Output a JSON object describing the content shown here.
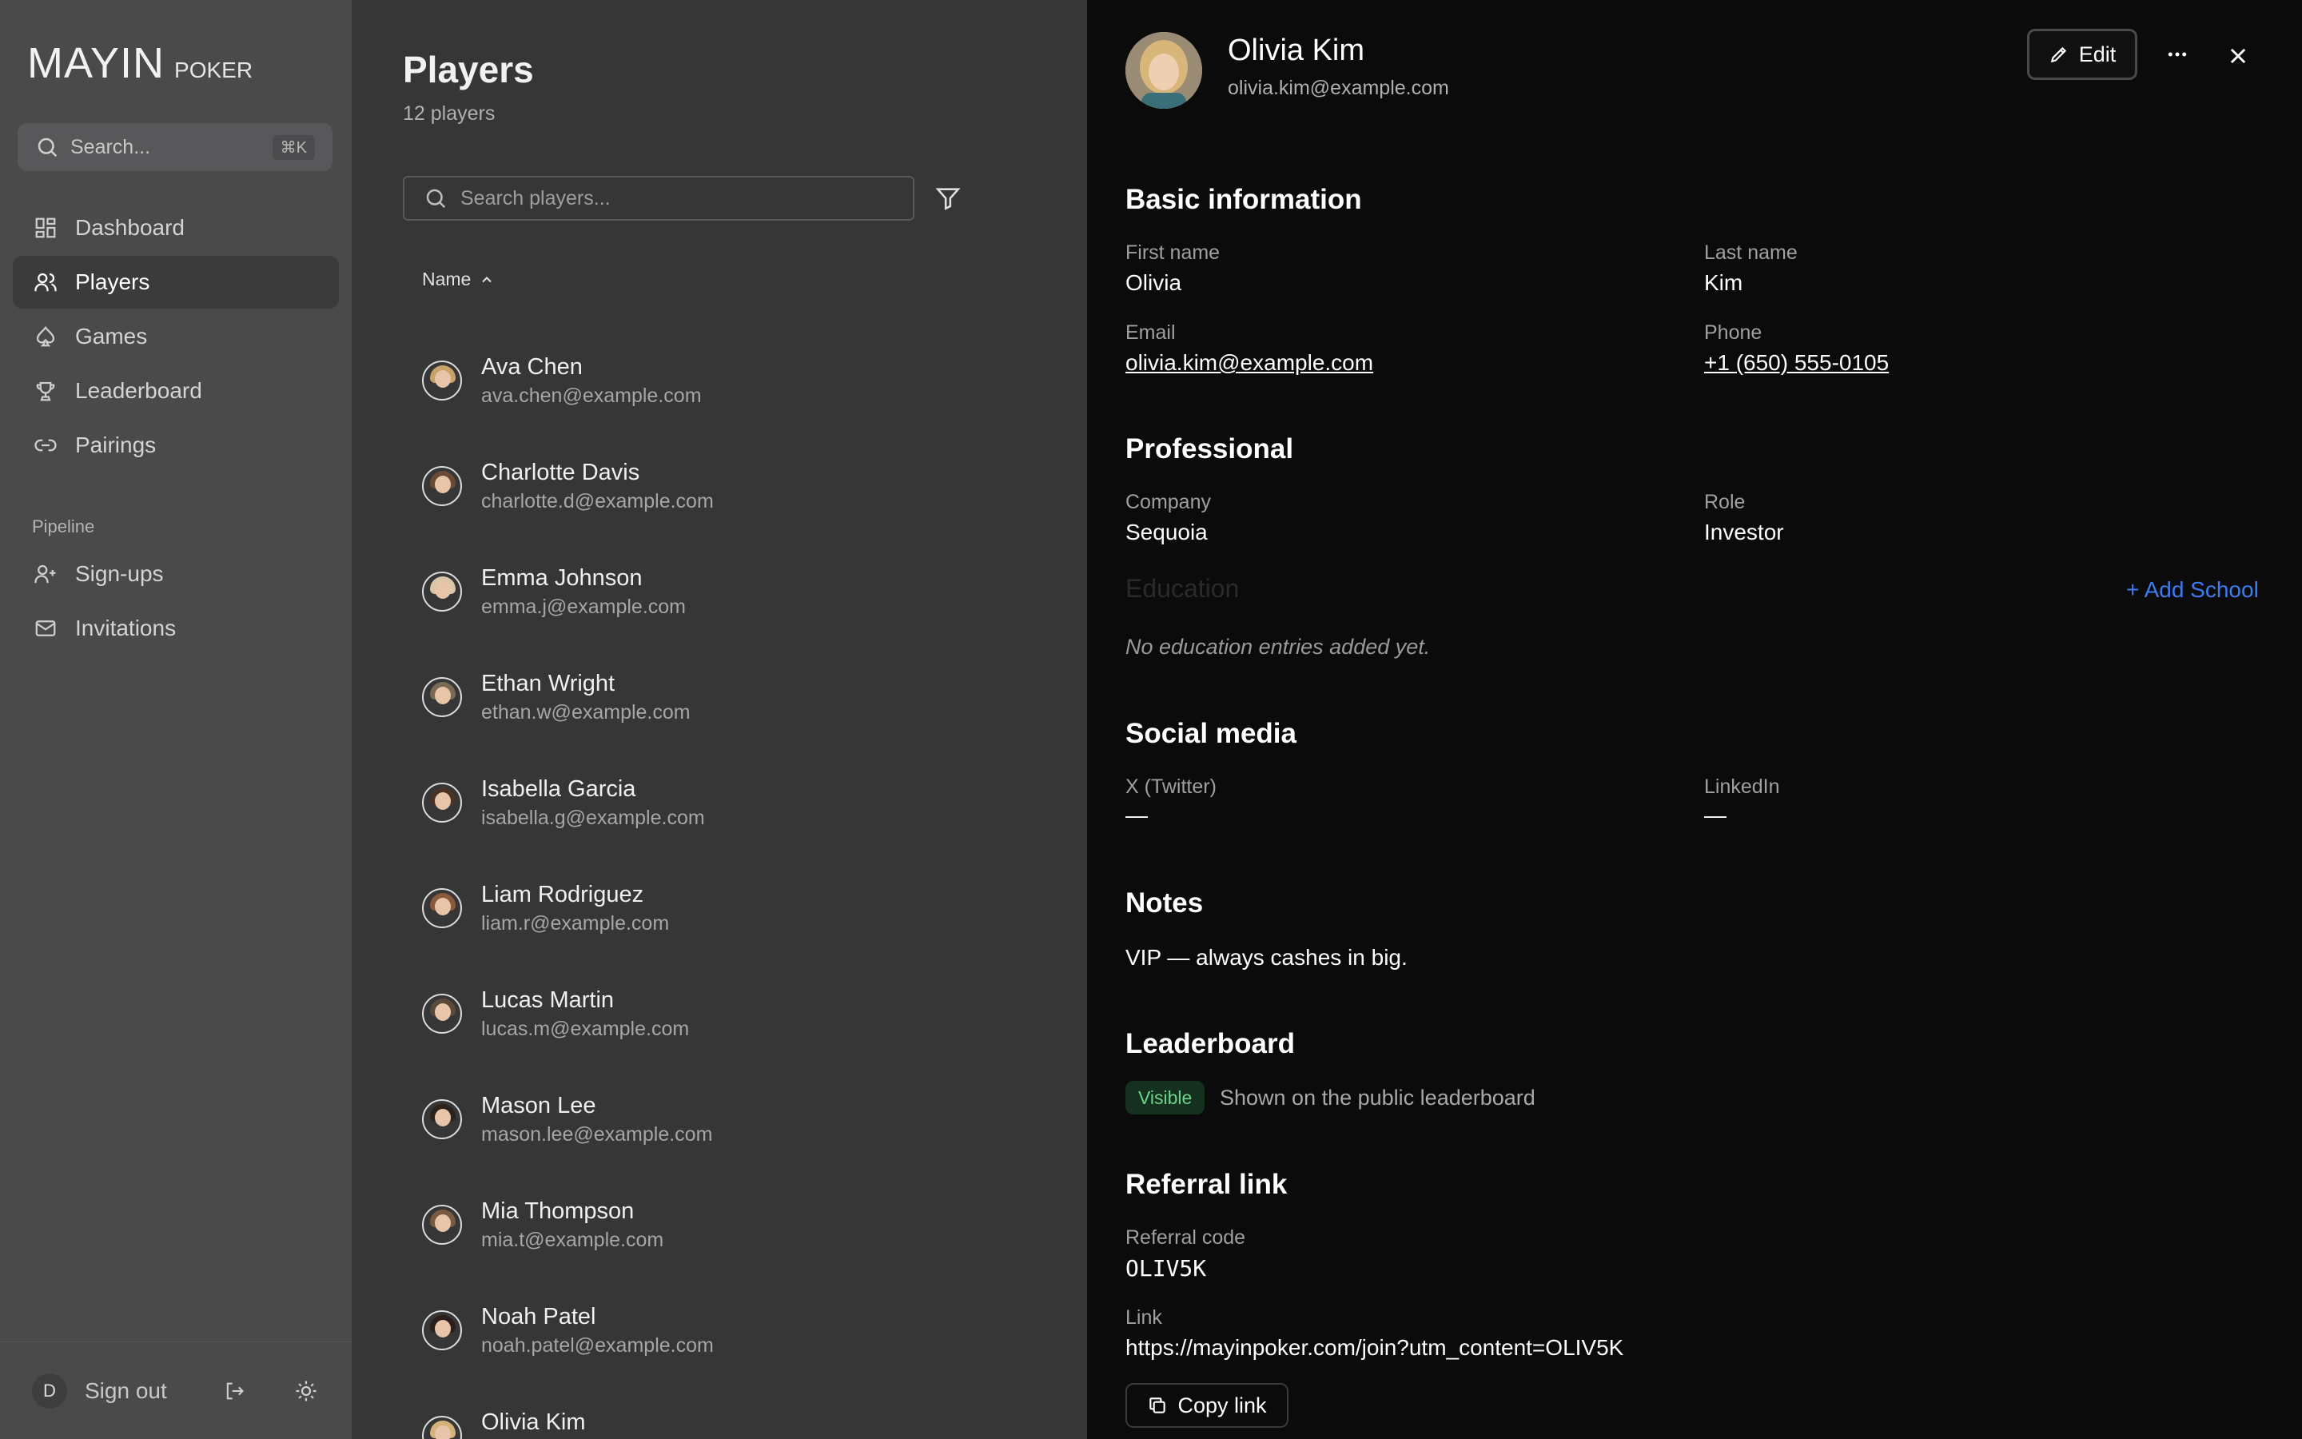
{
  "brand": {
    "main": "MAYIN",
    "sub": "POKER"
  },
  "sidebar": {
    "search_placeholder": "Search...",
    "search_shortcut": "⌘K",
    "items": [
      {
        "label": "Dashboard",
        "icon": "dashboard-icon"
      },
      {
        "label": "Players",
        "icon": "users-icon",
        "active": true
      },
      {
        "label": "Games",
        "icon": "spade-icon"
      },
      {
        "label": "Leaderboard",
        "icon": "trophy-icon"
      },
      {
        "label": "Pairings",
        "icon": "link-icon"
      }
    ],
    "section_label": "Pipeline",
    "pipeline_items": [
      {
        "label": "Sign-ups",
        "icon": "user-plus-icon"
      },
      {
        "label": "Invitations",
        "icon": "mail-icon"
      }
    ],
    "user_initial": "D",
    "signout_label": "Sign out"
  },
  "players": {
    "title": "Players",
    "count_label": "12 players",
    "search_placeholder": "Search players...",
    "column_header": "Name",
    "rows": [
      {
        "name": "Ava Chen",
        "email": "ava.chen@example.com",
        "hair": "#c9a26a"
      },
      {
        "name": "Charlotte Davis",
        "email": "charlotte.d@example.com",
        "hair": "#6b4a35"
      },
      {
        "name": "Emma Johnson",
        "email": "emma.j@example.com",
        "hair": "#d9c7a8"
      },
      {
        "name": "Ethan Wright",
        "email": "ethan.w@example.com",
        "hair": "#7a6a55"
      },
      {
        "name": "Isabella Garcia",
        "email": "isabella.g@example.com",
        "hair": "#4a3226"
      },
      {
        "name": "Liam Rodriguez",
        "email": "liam.r@example.com",
        "hair": "#8a5a3a"
      },
      {
        "name": "Lucas Martin",
        "email": "lucas.m@example.com",
        "hair": "#5a4a3c"
      },
      {
        "name": "Mason Lee",
        "email": "mason.lee@example.com",
        "hair": "#2c221c"
      },
      {
        "name": "Mia Thompson",
        "email": "mia.t@example.com",
        "hair": "#7a5a40"
      },
      {
        "name": "Noah Patel",
        "email": "noah.patel@example.com",
        "hair": "#2a1f1a"
      },
      {
        "name": "Olivia Kim",
        "email": "olivia.kim@example.com",
        "hair": "#d4b27a"
      }
    ]
  },
  "detail": {
    "name": "Olivia Kim",
    "email": "olivia.kim@example.com",
    "edit_label": "Edit",
    "basic": {
      "heading": "Basic information",
      "first_name_label": "First name",
      "first_name": "Olivia",
      "last_name_label": "Last name",
      "last_name": "Kim",
      "email_label": "Email",
      "email": "olivia.kim@example.com",
      "phone_label": "Phone",
      "phone": "+1 (650) 555-0105"
    },
    "professional": {
      "heading": "Professional",
      "company_label": "Company",
      "company": "Sequoia",
      "role_label": "Role",
      "role": "Investor"
    },
    "education": {
      "heading": "Education",
      "add_label": "+ Add School",
      "empty": "No education entries added yet."
    },
    "social": {
      "heading": "Social media",
      "twitter_label": "X (Twitter)",
      "twitter": "—",
      "linkedin_label": "LinkedIn",
      "linkedin": "—"
    },
    "notes": {
      "heading": "Notes",
      "text": "VIP — always cashes in big."
    },
    "leaderboard": {
      "heading": "Leaderboard",
      "badge": "Visible",
      "desc": "Shown on the public leaderboard",
      "badge_color": "#6ad48c"
    },
    "referral": {
      "heading": "Referral link",
      "code_label": "Referral code",
      "code": "OLIV5K",
      "link_label": "Link",
      "link": "https://mayinpoker.com/join?utm_content=OLIV5K",
      "copy_label": "Copy link"
    }
  }
}
